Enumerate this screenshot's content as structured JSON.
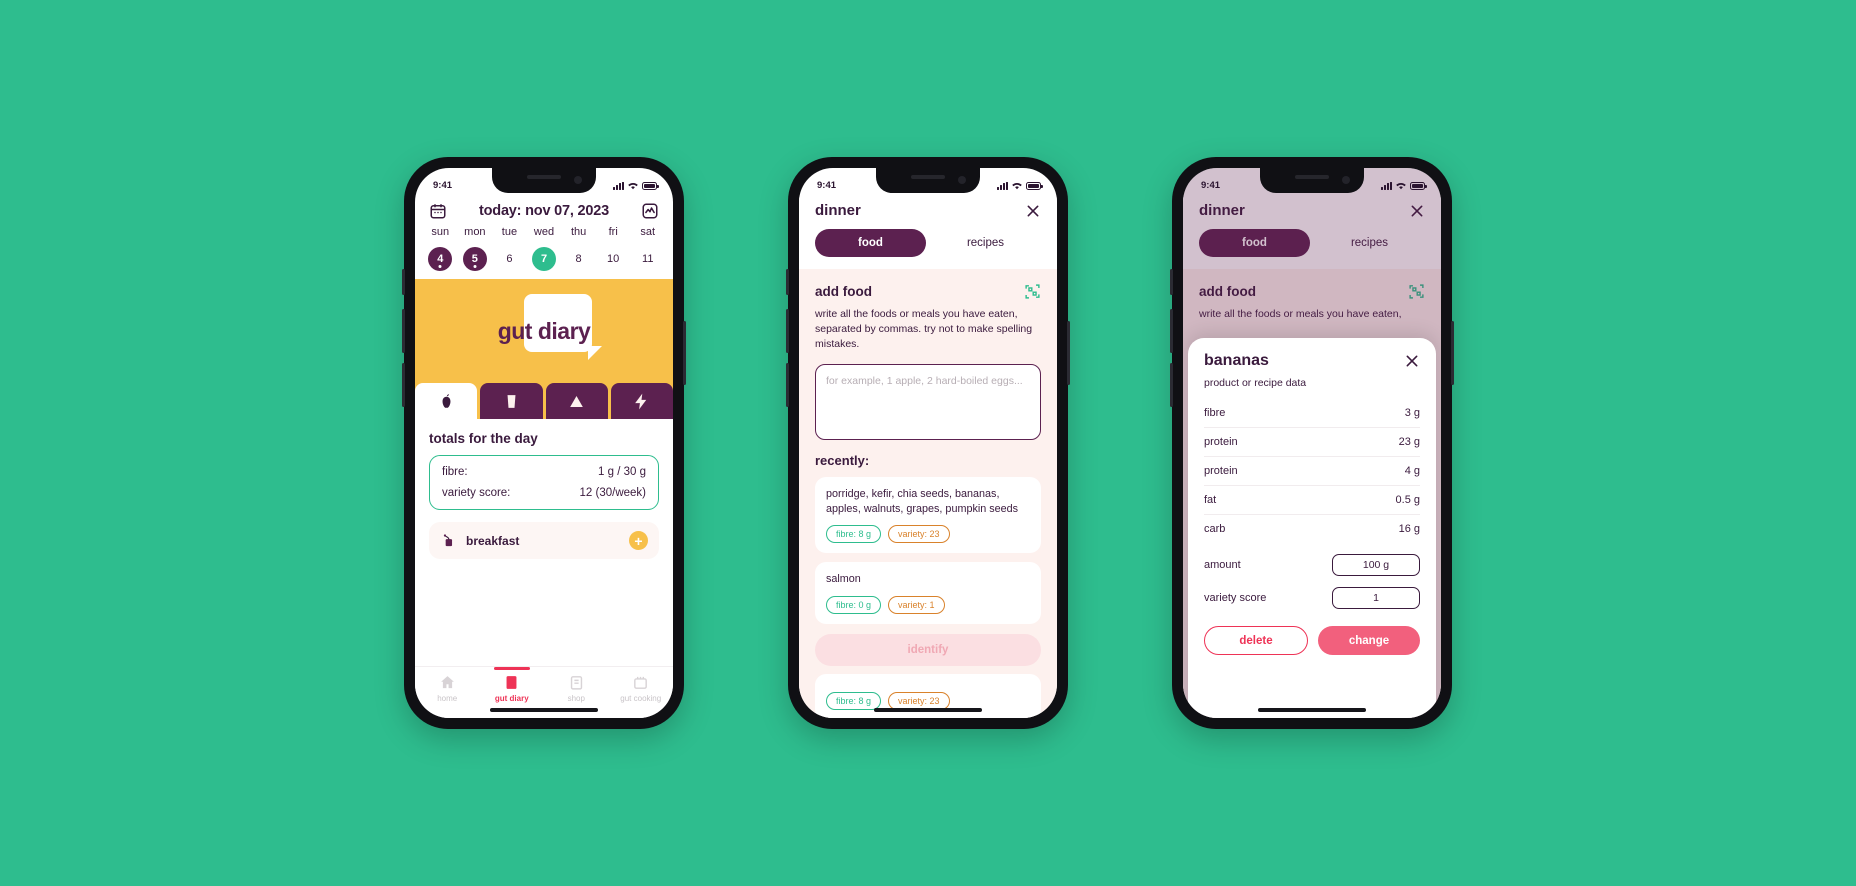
{
  "theme": {
    "background": "#2ebd8e",
    "plum": "#5c2150",
    "ink": "#3a1a3d",
    "yellow": "#f7c04a",
    "green": "#2ebd8e",
    "pink": "#ee3356",
    "orange": "#d9822b",
    "cream": "#fdf1ee"
  },
  "status_bar": {
    "time": "9:41"
  },
  "phone1": {
    "header": {
      "calendar_icon": "calendar-icon",
      "title": "today: nov 07, 2023",
      "chart_icon": "activity-chart-icon"
    },
    "week": {
      "weekdays": [
        "sun",
        "mon",
        "tue",
        "wed",
        "thu",
        "fri",
        "sat"
      ],
      "days": [
        {
          "num": "4",
          "state": "logged"
        },
        {
          "num": "5",
          "state": "logged"
        },
        {
          "num": "6",
          "state": "plain"
        },
        {
          "num": "7",
          "state": "today"
        },
        {
          "num": "8",
          "state": "plain"
        },
        {
          "num": "10",
          "state": "plain"
        },
        {
          "num": "11",
          "state": "plain"
        }
      ]
    },
    "hero": {
      "logo_text": "gut diary"
    },
    "tabs": [
      {
        "icon": "apple-icon",
        "active": true
      },
      {
        "icon": "glass-icon",
        "active": false
      },
      {
        "icon": "poop-icon",
        "active": false
      },
      {
        "icon": "bolt-icon",
        "active": false
      }
    ],
    "totals": {
      "heading": "totals for the day",
      "rows": [
        {
          "label": "fibre:",
          "value": "1 g / 30 g"
        },
        {
          "label": "variety score:",
          "value": "12 (30/week)"
        }
      ]
    },
    "meals": [
      {
        "icon": "teabag-icon",
        "name": "breakfast",
        "add_label": "+"
      }
    ],
    "nav": [
      {
        "icon": "home-icon",
        "label": "home",
        "active": false
      },
      {
        "icon": "diary-icon",
        "label": "gut diary",
        "active": true
      },
      {
        "icon": "shop-icon",
        "label": "shop",
        "active": false
      },
      {
        "icon": "cooking-icon",
        "label": "gut cooking",
        "active": false
      }
    ]
  },
  "phone2": {
    "title": "dinner",
    "close_icon": "close-icon",
    "segments": [
      {
        "label": "food",
        "selected": true
      },
      {
        "label": "recipes",
        "selected": false
      }
    ],
    "add_food": {
      "heading": "add food",
      "qr_icon": "qr-scan-icon",
      "help": "write all the foods or meals you have eaten, separated by commas. try not to make spelling mistakes.",
      "input_placeholder": "for example, 1 apple, 2 hard-boiled eggs..."
    },
    "recently_label": "recently:",
    "recent_items": [
      {
        "text": "porridge, kefir, chia seeds, bananas, apples, walnuts, grapes, pumpkin seeds",
        "fibre": "fibre: 8 g",
        "variety": "variety: 23"
      },
      {
        "text": "salmon",
        "fibre": "fibre: 0 g",
        "variety": "variety: 1"
      }
    ],
    "identify_button": "identify"
  },
  "phone3": {
    "title": "dinner",
    "close_icon": "close-icon",
    "segments": [
      {
        "label": "food",
        "selected": true
      },
      {
        "label": "recipes",
        "selected": false
      }
    ],
    "add_food": {
      "heading": "add food",
      "qr_icon": "qr-scan-icon",
      "help": "write all the foods or meals you have eaten,"
    },
    "modal": {
      "title": "bananas",
      "close_icon": "close-icon",
      "subtitle": "product or recipe data",
      "nutrients": [
        {
          "label": "fibre",
          "value": "3 g"
        },
        {
          "label": "protein",
          "value": "23 g"
        },
        {
          "label": "protein",
          "value": "4 g"
        },
        {
          "label": "fat",
          "value": "0.5 g"
        },
        {
          "label": "carb",
          "value": "16 g"
        }
      ],
      "inputs": [
        {
          "label": "amount",
          "value": "100 g"
        },
        {
          "label": "variety score",
          "value": "1"
        }
      ],
      "buttons": [
        {
          "label": "delete",
          "style": "outline"
        },
        {
          "label": "change",
          "style": "filled"
        }
      ]
    }
  }
}
